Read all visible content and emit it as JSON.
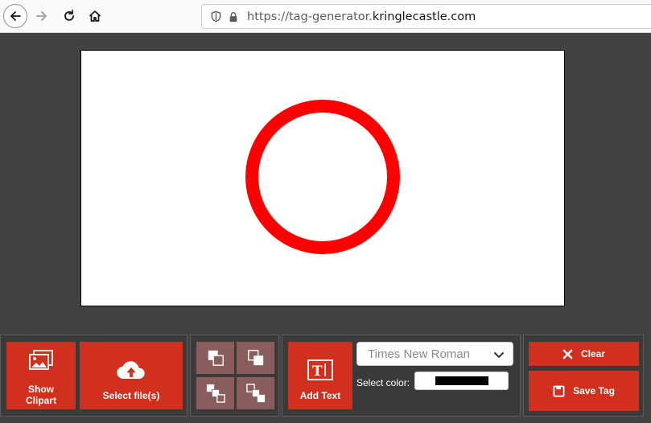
{
  "browser": {
    "url_prefix": "https://tag-generator.",
    "url_domain": "kringlecastle.com",
    "icons": [
      "back-arrow-icon",
      "forward-arrow-icon",
      "reload-icon",
      "home-icon",
      "shield-icon",
      "lock-icon"
    ]
  },
  "canvas": {
    "shape": "circle",
    "stroke_color": "#ff0000",
    "background": "#ffffff"
  },
  "toolbar": {
    "show_clipart_label": "Show Clipart",
    "select_files_label": "Select file(s)",
    "layer_buttons": [
      "bring-forward-icon",
      "send-backward-icon",
      "bring-to-front-icon",
      "send-to-back-icon"
    ],
    "add_text_label": "Add Text",
    "font_selected": "Times New Roman",
    "select_color_label": "Select color:",
    "selected_color": "#000000",
    "clear_label": "Clear",
    "save_tag_label": "Save Tag",
    "accent_color": "#d1301f"
  }
}
